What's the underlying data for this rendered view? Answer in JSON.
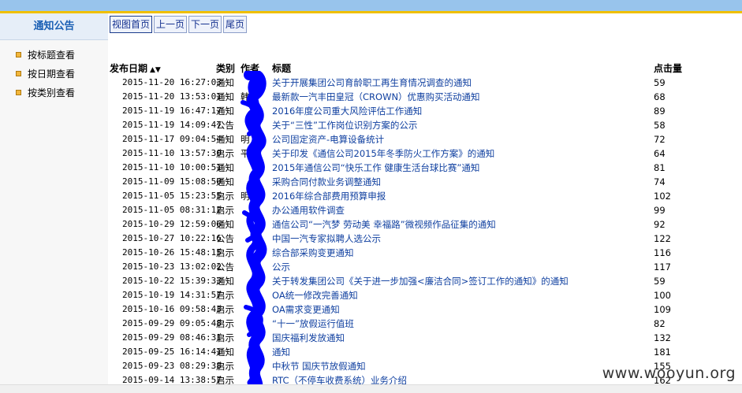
{
  "sidebar": {
    "title": "通知公告",
    "items": [
      "按标题查看",
      "按日期查看",
      "按类别查看"
    ]
  },
  "toolbar": [
    "视图首页",
    "上一页",
    "下一页",
    "尾页"
  ],
  "headers": {
    "date": "发布日期",
    "type": "类别",
    "author": "作者",
    "title": "标题",
    "clicks": "点击量"
  },
  "rows": [
    {
      "date": "2015-11-20 16:27:03",
      "type": "通知",
      "author": "",
      "title": "关于开展集团公司育龄职工再生育情况调查的通知",
      "clicks": "59"
    },
    {
      "date": "2015-11-20 13:53:01",
      "type": "通知",
      "author": "韩",
      "title": "最新款一汽丰田皇冠（CROWN）优惠购买活动通知",
      "clicks": "68"
    },
    {
      "date": "2015-11-19 16:47:17",
      "type": "通知",
      "author": "",
      "title": "2016年度公司重大风险评估工作通知",
      "clicks": "89"
    },
    {
      "date": "2015-11-19 14:09:47",
      "type": "公告",
      "author": "",
      "title": "关于“三性”工作岗位识别方案的公示",
      "clicks": "58"
    },
    {
      "date": "2015-11-17 09:04:54",
      "type": "通知",
      "author": "明",
      "title": "公司固定资产-电算设备统计",
      "clicks": "72"
    },
    {
      "date": "2015-11-10 13:57:30",
      "type": "启示",
      "author": "平",
      "title": "关于印发《通信公司2015年冬季防火工作方案》的通知",
      "clicks": "64"
    },
    {
      "date": "2015-11-10 10:00:51",
      "type": "通知",
      "author": "",
      "title": "2015年通信公司“快乐工作  健康生活台球比赛”通知",
      "clicks": "81"
    },
    {
      "date": "2015-11-09 15:08:50",
      "type": "通知",
      "author": "",
      "title": "采购合同付款业务调整通知",
      "clicks": "74"
    },
    {
      "date": "2015-11-05 15:23:55",
      "type": "启示",
      "author": "明",
      "title": "2016年综合部费用预算申报",
      "clicks": "102"
    },
    {
      "date": "2015-11-05 08:31:12",
      "type": "启示",
      "author": "",
      "title": "办公通用软件调查",
      "clicks": "99"
    },
    {
      "date": "2015-10-29 12:59:06",
      "type": "通知",
      "author": "",
      "title": "通信公司“一汽梦  劳动美  幸福路”微视频作品征集的通知",
      "clicks": "92"
    },
    {
      "date": "2015-10-27 10:22:16",
      "type": "公告",
      "author": "",
      "title": "中国一汽专家拟聘人选公示",
      "clicks": "122"
    },
    {
      "date": "2015-10-26 15:48:15",
      "type": "启示",
      "author": "",
      "title": "综合部采购变更通知",
      "clicks": "116"
    },
    {
      "date": "2015-10-23 13:02:02",
      "type": "公告",
      "author": "",
      "title": "公示",
      "clicks": "117"
    },
    {
      "date": "2015-10-22 15:39:33",
      "type": "通知",
      "author": "",
      "title": "关于转发集团公司《关于进一步加强<廉洁合同>签订工作的通知》的通知",
      "clicks": "59"
    },
    {
      "date": "2015-10-19 14:31:57",
      "type": "启示",
      "author": "",
      "title": "OA统一修改完善通知",
      "clicks": "100"
    },
    {
      "date": "2015-10-16 09:58:43",
      "type": "启示",
      "author": "",
      "title": "OA需求变更通知",
      "clicks": "109"
    },
    {
      "date": "2015-09-29 09:05:48",
      "type": "启示",
      "author": "",
      "title": "“十一”放假运行值班",
      "clicks": "82"
    },
    {
      "date": "2015-09-29 08:46:31",
      "type": "启示",
      "author": "",
      "title": "国庆福利发放通知",
      "clicks": "132"
    },
    {
      "date": "2015-09-25 16:14:41",
      "type": "通知",
      "author": "",
      "title": "通知",
      "clicks": "181"
    },
    {
      "date": "2015-09-23 08:29:38",
      "type": "启示",
      "author": "",
      "title": "中秋节  国庆节放假通知",
      "clicks": "155"
    },
    {
      "date": "2015-09-14 13:38:57",
      "type": "启示",
      "author": "",
      "title": "RTC（不停车收费系统）业务介绍",
      "clicks": "162"
    }
  ],
  "watermark": "www.wooyun.org",
  "colors": {
    "link": "#1040a0",
    "topbar": "#98c4ec",
    "accent": "#f0c000",
    "redaction": "#0000ff"
  }
}
